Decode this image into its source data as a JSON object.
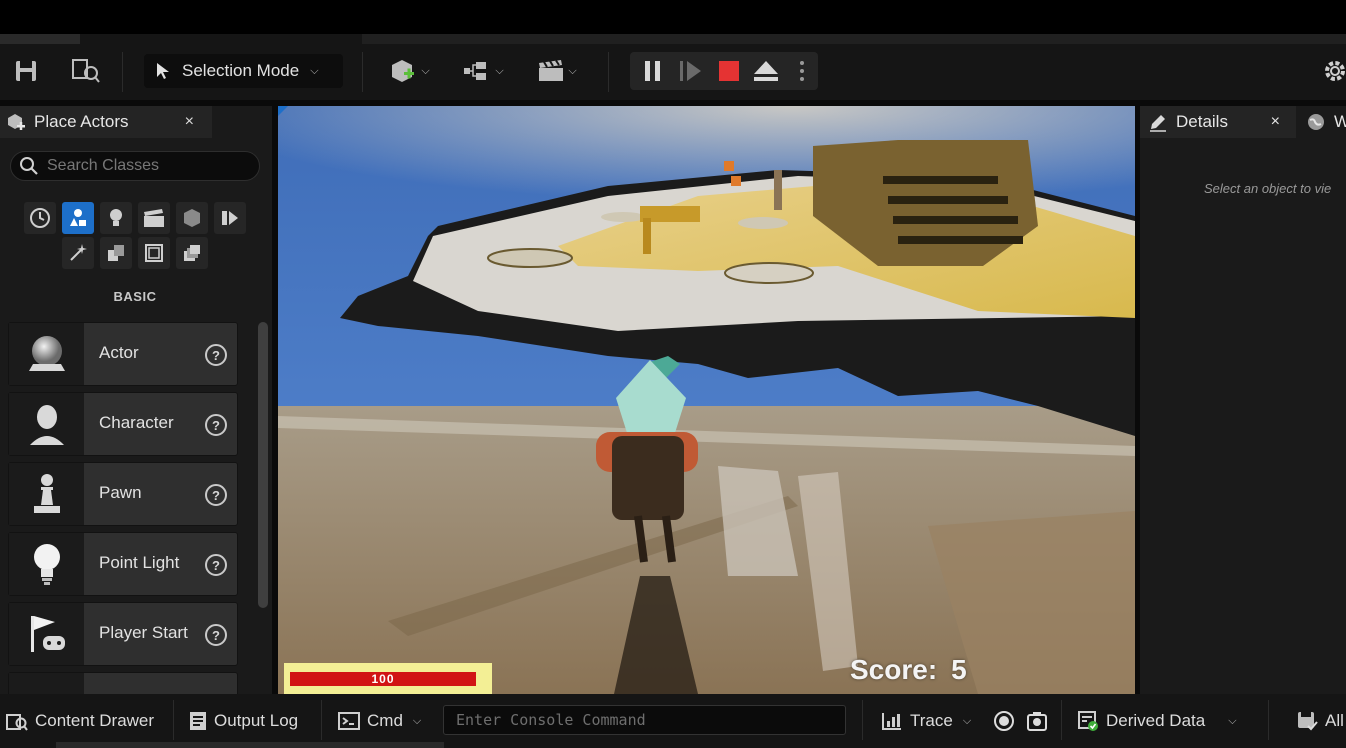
{
  "toolbar": {
    "selection_mode": "Selection Mode",
    "play_colors": {
      "stop": "#e53333",
      "accent": "#1d6fc9"
    }
  },
  "place_actors": {
    "tab_label": "Place Actors",
    "close": "×",
    "search_placeholder": "Search Classes",
    "section": "BASIC",
    "items": [
      {
        "label": "Actor",
        "icon": "sphere-icon"
      },
      {
        "label": "Character",
        "icon": "character-icon"
      },
      {
        "label": "Pawn",
        "icon": "pawn-icon"
      },
      {
        "label": "Point Light",
        "icon": "lightbulb-icon"
      },
      {
        "label": "Player Start",
        "icon": "player-start-icon"
      }
    ],
    "help": "?"
  },
  "viewport": {
    "health_value": "100",
    "health_fraction": 1.0,
    "score_label": "Score:",
    "score_value": "5"
  },
  "details": {
    "tab_label": "Details",
    "close": "×",
    "world_tab_label": "W",
    "hint": "Select an object to vie"
  },
  "bottom": {
    "content_drawer": "Content Drawer",
    "output_log": "Output Log",
    "cmd": "Cmd",
    "console_placeholder": "Enter Console Command",
    "trace": "Trace",
    "derived_data": "Derived Data",
    "all": "All"
  }
}
